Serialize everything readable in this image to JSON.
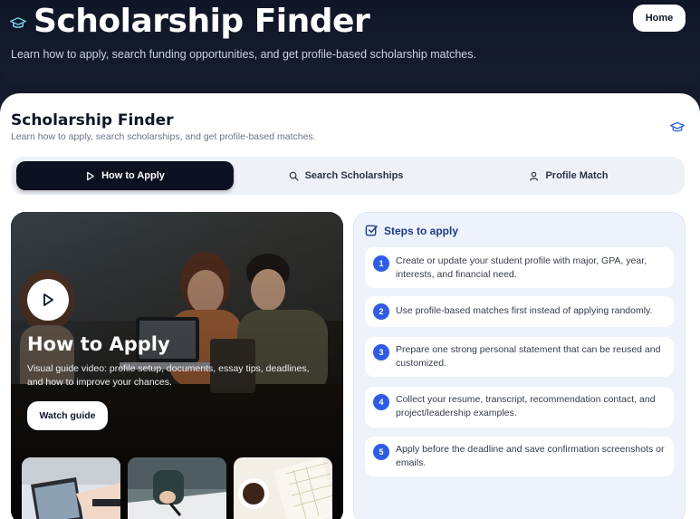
{
  "header": {
    "title": "Scholarship Finder",
    "subtitle": "Learn how to apply, search funding opportunities, and get profile-based scholarship matches.",
    "home_label": "Home",
    "icon": "graduation-cap-icon"
  },
  "card": {
    "title": "Scholarship Finder",
    "subtitle": "Learn how to apply, search scholarships, and get profile-based matches.",
    "icon": "graduation-cap-icon"
  },
  "tabs": [
    {
      "label": "How to Apply",
      "icon": "play-icon",
      "active": true
    },
    {
      "label": "Search Scholarships",
      "icon": "search-icon",
      "active": false
    },
    {
      "label": "Profile Match",
      "icon": "user-icon",
      "active": false
    }
  ],
  "hero": {
    "title": "How to Apply",
    "description": "Visual guide video: profile setup, documents, essay tips, deadlines, and how to improve your chances.",
    "button_label": "Watch guide"
  },
  "steps": {
    "title": "Steps to apply",
    "items": [
      {
        "number": "1",
        "text": "Create or update your student profile with major, GPA, year, interests, and financial need."
      },
      {
        "number": "2",
        "text": "Use profile-based matches first instead of applying randomly."
      },
      {
        "number": "3",
        "text": "Prepare one strong personal statement that can be reused and customized."
      },
      {
        "number": "4",
        "text": "Collect your resume, transcript, recommendation contact, and project/leadership examples."
      },
      {
        "number": "5",
        "text": "Apply before the deadline and save confirmation screenshots or emails."
      }
    ]
  },
  "colors": {
    "header_bg": "#131a2b",
    "active_tab": "#0b1120",
    "accent": "#2f5ce6",
    "steps_bg": "#eef3fb"
  }
}
